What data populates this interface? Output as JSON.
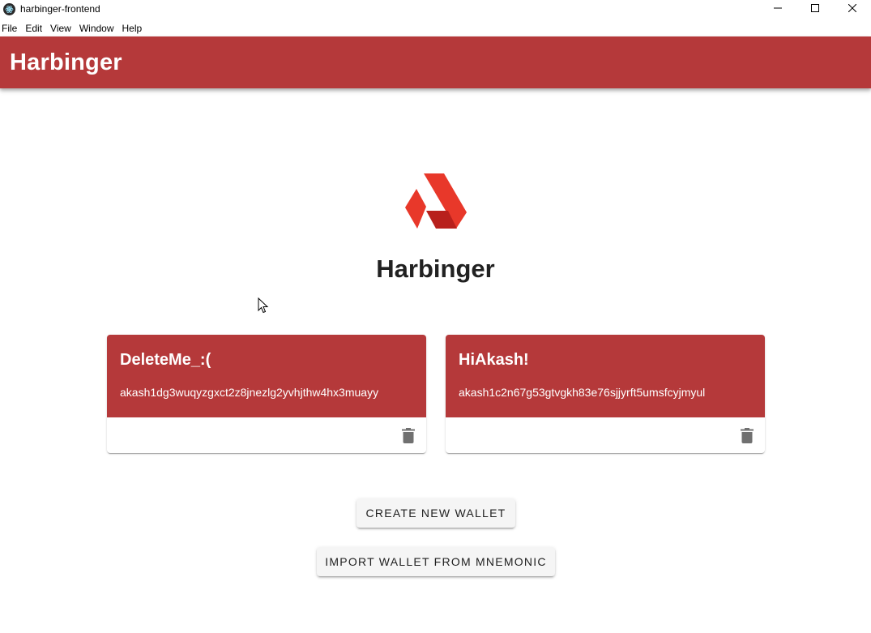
{
  "window": {
    "title": "harbinger-frontend"
  },
  "menu": {
    "items": [
      "File",
      "Edit",
      "View",
      "Window",
      "Help"
    ]
  },
  "appbar": {
    "title": "Harbinger",
    "color": "#b5393a"
  },
  "main": {
    "title": "Harbinger",
    "logo": "akash-logo-icon"
  },
  "wallets": [
    {
      "name": "DeleteMe_:(",
      "address": "akash1dg3wuqyzgxct2z8jnezlg2yvhjthw4hx3muayy"
    },
    {
      "name": "HiAkash!",
      "address": "akash1c2n67g53gtvgkh83e76sjjyrft5umsfcyjmyul"
    }
  ],
  "actions": {
    "create_label": "CREATE NEW WALLET",
    "import_label": "IMPORT WALLET FROM MNEMONIC"
  },
  "colors": {
    "accent": "#b5393a",
    "logo_red": "#e8382a",
    "logo_dark": "#b8201c"
  }
}
